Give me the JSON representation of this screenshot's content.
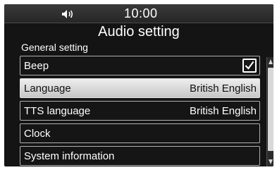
{
  "status": {
    "time": "10:00",
    "volume_icon": "speaker-volume-icon"
  },
  "header": {
    "title": "Audio setting",
    "section": "General setting"
  },
  "items": [
    {
      "label": "Beep",
      "value": "",
      "checked": true
    },
    {
      "label": "Language",
      "value": "British English",
      "selected": true
    },
    {
      "label": "TTS language",
      "value": "British English"
    },
    {
      "label": "Clock",
      "value": ""
    },
    {
      "label": "System information",
      "value": ""
    }
  ],
  "colors": {
    "background": "#141414",
    "selected_row": "#d9d9d9",
    "text": "#ffffff"
  }
}
